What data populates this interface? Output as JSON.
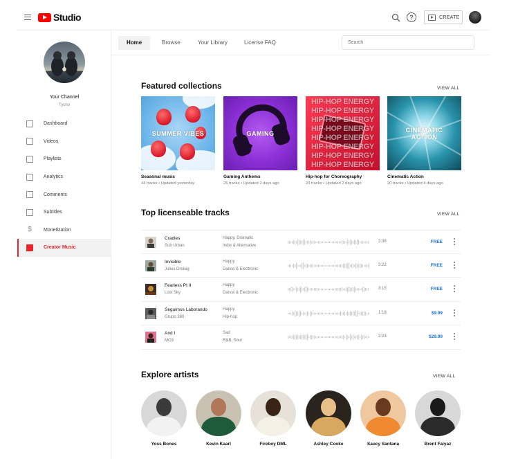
{
  "header": {
    "logo_text": "Studio",
    "create_label": "CREATE"
  },
  "sidebar": {
    "channel_name": "Your Channel",
    "channel_handle": "Tycho",
    "items": [
      {
        "label": "Dashboard",
        "icon": "dashboard-icon"
      },
      {
        "label": "Videos",
        "icon": "videos-icon"
      },
      {
        "label": "Playlists",
        "icon": "playlists-icon"
      },
      {
        "label": "Analytics",
        "icon": "analytics-icon"
      },
      {
        "label": "Comments",
        "icon": "comments-icon"
      },
      {
        "label": "Subtitles",
        "icon": "subtitles-icon"
      },
      {
        "label": "Monetization",
        "icon": "dollar-icon"
      },
      {
        "label": "Creator Music",
        "icon": "creator-music-icon",
        "active": true
      }
    ],
    "accent_color": "#e8262b"
  },
  "tabs": [
    {
      "label": "Home",
      "active": true
    },
    {
      "label": "Browse"
    },
    {
      "label": "Your Library"
    },
    {
      "label": "License FAQ"
    }
  ],
  "search": {
    "placeholder": "Search"
  },
  "featured": {
    "title": "Featured collections",
    "view_all": "VIEW ALL",
    "items": [
      {
        "art_text": "SUMMER VIBES",
        "title": "Seasonal music",
        "tracks": "44 tracks",
        "updated": "Updated yesterday"
      },
      {
        "art_text": "GAMING",
        "title": "Gaming Anthems",
        "tracks": "26 tracks",
        "updated": "Updated 2 days ago"
      },
      {
        "art_text": "HIP-HOP ENERGY",
        "title": "Hip-hop for Choreography",
        "tracks": "23 tracks",
        "updated": "Updated 2 days ago"
      },
      {
        "art_text": "CINEMATIC ACTION",
        "title": "Cinematic Action",
        "tracks": "20 tracks",
        "updated": "Updated 4 days ago"
      }
    ]
  },
  "top_tracks": {
    "title": "Top licenseable tracks",
    "view_all": "VIEW ALL",
    "price_color": "#1a73e8",
    "items": [
      {
        "name": "Cradles",
        "artist": "Sub Urban",
        "mood": "Happy, Dramatic",
        "genre": "Indie & Alternative",
        "duration": "3:38",
        "price": "FREE"
      },
      {
        "name": "Invisible",
        "artist": "Julius Dreisig",
        "mood": "Happy",
        "genre": "Dance & Electronic",
        "duration": "3:22",
        "price": "FREE"
      },
      {
        "name": "Fearless Pt II",
        "artist": "Lost Sky",
        "mood": "Happy",
        "genre": "Dance & Electronic",
        "duration": "3:15",
        "price": "FREE"
      },
      {
        "name": "Seguimos Laborando",
        "artist": "Grupo 360",
        "mood": "Happy",
        "genre": "Hip-hop",
        "duration": "1:18",
        "price": "$9.99"
      },
      {
        "name": "And I",
        "artist": "MO3",
        "mood": "Sad",
        "genre": "R&B, Soul",
        "duration": "3:23",
        "price": "$29.99"
      }
    ]
  },
  "artists": {
    "title": "Explore artists",
    "view_all": "VIEW ALL",
    "items": [
      {
        "name": "Yoss Bones"
      },
      {
        "name": "Kevin Kaarl"
      },
      {
        "name": "Fireboy DML"
      },
      {
        "name": "Ashley Cooke"
      },
      {
        "name": "Saucy Santana"
      },
      {
        "name": "Brent Faiyaz"
      }
    ]
  }
}
